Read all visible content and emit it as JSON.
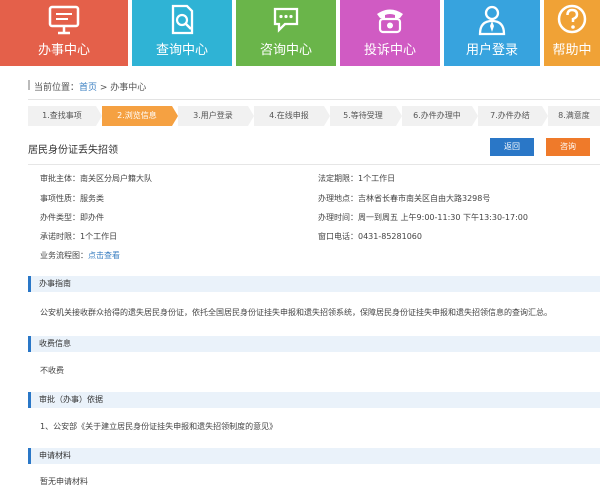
{
  "nav": [
    {
      "label": "办事中心",
      "icon": "monitor-icon"
    },
    {
      "label": "查询中心",
      "icon": "search-doc-icon"
    },
    {
      "label": "咨询中心",
      "icon": "chat-icon"
    },
    {
      "label": "投诉中心",
      "icon": "telephone-icon"
    },
    {
      "label": "用户登录",
      "icon": "user-icon"
    },
    {
      "label": "帮助中",
      "icon": "help-icon"
    }
  ],
  "breadcrumb": {
    "prefix": "当前位置：",
    "home": "首页",
    "sep": " > ",
    "current": "办事中心"
  },
  "steps": [
    "1.查找事项",
    "2.浏览信息",
    "3.用户登录",
    "4.在线申报",
    "5.等待受理",
    "6.办件办理中",
    "7.办件办结",
    "8.满意度"
  ],
  "title": "居民身份证丢失招领",
  "buttons": {
    "back": "返回",
    "consult": "咨询"
  },
  "info": {
    "subject": "审批主体：南关区分局户籍大队",
    "category": "事项性质：服务类",
    "basis": "办件类型：即办件",
    "promise": "承诺时限：1个工作日",
    "flow_label": "业务流程图：",
    "flow_link": "点击查看",
    "legal": "法定期限：1个工作日",
    "address": "办理地点：吉林省长春市南关区自由大路3298号",
    "hours": "办理时间：周一到周五 上午9:00-11:30 下午13:30-17:00",
    "phone": "窗口电话：0431-85281060"
  },
  "sections": {
    "guide_head": "办事指南",
    "guide_text": "公安机关接收群众拾得的遗失居民身份证，依托全国居民身份证挂失申报和遗失招领系统，保障居民身份证挂失申报和遗失招领信息的查询汇总。",
    "fee_head": "收费信息",
    "fee_text": "不收费",
    "law_head": "审批（办事）依据",
    "law_text": "1、公安部《关于建立居民身份证挂失申报和遗失招领制度的意见》",
    "material_head": "申请材料",
    "material_text": "暂无申请材料"
  }
}
